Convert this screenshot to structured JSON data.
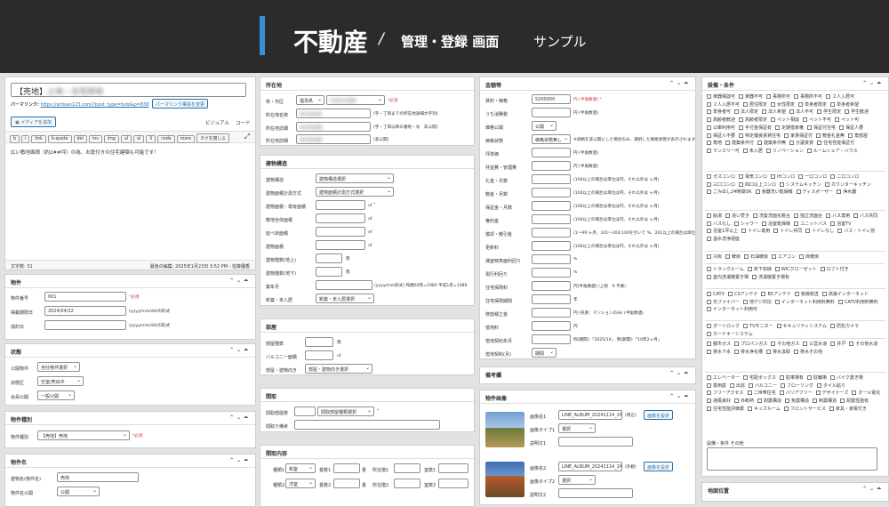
{
  "banner": {
    "title": "不動産",
    "slash": "/",
    "subtitle": "管理・登録 画面",
    "sample": "サンプル"
  },
  "post": {
    "title_prefix": "【売地】",
    "title_blur": "土地・住宅用地",
    "permalink_label": "パーマリンク:",
    "permalink_url": "https://artisan123.com/?post_type=fudo&p=838",
    "permalink_btn": "パーマリンク構造を変更",
    "media_btn": "メディアを追加",
    "tab_visual": "ビジュアル",
    "tab_code": "コード",
    "qtags": [
      "b",
      "i",
      "link",
      "b-quote",
      "del",
      "ins",
      "img",
      "ul",
      "ol",
      "li",
      "code",
      "more",
      "タグを閉じる"
    ],
    "body_text": "広い敷地面積（約2##坪）の為、お庭付きの住宅建築も可能です！",
    "wordcount": "文字数: 31",
    "lastedit": "最後の編集: 2025年1月23日 3:52 PM - 佐藤優香"
  },
  "col1": {
    "bukken": {
      "title": "物件",
      "rows": [
        {
          "label": "物件番号",
          "value": "001",
          "note": "*必須"
        },
        {
          "label": "掲載期限日",
          "value": "2024/04/22",
          "note": "(yyyy/mm/dd)の形式"
        },
        {
          "label": "成約日",
          "value": "",
          "note": "(yyyy/mm/dd)の形式"
        }
      ]
    },
    "jotai": {
      "title": "状態",
      "rows": [
        {
          "label": "公開物件",
          "value": "自社物件選択"
        },
        {
          "label": "状態区",
          "value": "空室/売出中"
        },
        {
          "label": "会員公開",
          "value": "一般公開"
        }
      ]
    },
    "shubetsu": {
      "title": "物件種別",
      "label": "物件種別",
      "value": "【売地】売地",
      "note": "*必須"
    },
    "name": {
      "title": "物件名",
      "rows": [
        {
          "label": "建物名(物件名)",
          "value": "売地"
        },
        {
          "label": "物件名公開",
          "value": "公開"
        }
      ]
    }
  },
  "col2": {
    "location": {
      "title": "所在地",
      "rows": [
        {
          "label": "県・市区",
          "v1": "福島県",
          "v2": "市区町村選択",
          "note": "*必須"
        },
        {
          "label": "所在地名称",
          "value": "所在地名称",
          "note": "(字・丁目までの所在地詳細文字列)"
        },
        {
          "label": "所在地詳細",
          "value": "所在地詳細",
          "note": "(字・丁目以降の番地・号　非公開)"
        },
        {
          "label": "所在地詳細",
          "value": "所在地詳細",
          "note": "(非公開)"
        }
      ]
    },
    "building": {
      "title": "建物構造",
      "rows": [
        {
          "label": "建物構造",
          "value": "建物構造選択"
        },
        {
          "label": "建物面積計測方式",
          "value": "建物面積計測方式選択"
        },
        {
          "label": "建物面積・専有面積",
          "value": "",
          "unit": "㎡",
          "note": "*"
        },
        {
          "label": "敷地全体面積",
          "value": "",
          "unit": "㎡"
        },
        {
          "label": "延べ床面積",
          "value": "",
          "unit": "㎡"
        },
        {
          "label": "建物面積",
          "value": "",
          "unit": "㎡"
        },
        {
          "label": "建物階数(地上)",
          "value": "",
          "unit": "階"
        },
        {
          "label": "建物階数(地下)",
          "value": "",
          "unit": "階"
        },
        {
          "label": "築年月",
          "value": "",
          "note": "(yyyy/mm形式) 和暦60年=1985 平成1年=1989"
        },
        {
          "label": "新築・未入居",
          "value": "新築・未入居選択"
        }
      ]
    },
    "heya": {
      "title": "部屋",
      "rows": [
        {
          "label": "部屋階数",
          "unit": "階"
        },
        {
          "label": "バルコニー面積",
          "unit": "㎡"
        },
        {
          "label": "部屋・建物向き",
          "value": "部屋・建物向き選択"
        }
      ]
    },
    "madori": {
      "title": "間取",
      "rows": [
        {
          "label": "間取部屋数",
          "value": "間取部屋種類選択",
          "note": "*"
        },
        {
          "label": "間取り備考",
          "value": ""
        }
      ]
    },
    "madori_detail": {
      "title": "間取内容",
      "labels": [
        "種類1",
        "畳数1",
        "畳",
        "所在階1",
        "室数1"
      ],
      "labels2": [
        "種類2",
        "畳数2",
        "畳",
        "所在階2",
        "室数2"
      ],
      "type1": "和室",
      "type2": "洋室"
    }
  },
  "col3": {
    "fees": {
      "title": "金額等",
      "rows": [
        {
          "label": "賃料・価格",
          "value": "5200000",
          "note": "円 (半角数値) *"
        },
        {
          "label": "うち消費税",
          "value": "",
          "note": "円 (半角数値)"
        },
        {
          "label": "価格公開",
          "value": "公開"
        },
        {
          "label": "価格状態",
          "value": "価格状態無し",
          "note": "※価格を非公開にした場合のみ、選択した価格状態が表示されます。"
        },
        {
          "label": "坪単価",
          "value": "",
          "note": "円 (半角数値)"
        },
        {
          "label": "共益費・管理費",
          "value": "",
          "note": "円 (半角数値)"
        },
        {
          "label": "礼金・月数",
          "value": "",
          "note": "(100以上の場合は単位は円、それ以外は ヶ月)"
        },
        {
          "label": "敷金・月数",
          "value": "",
          "note": "(100以上の場合は単位は円、それ以外は ヶ月)"
        },
        {
          "label": "保証金・月数",
          "value": "",
          "note": "(100以上の場合は単位は円、それ以外は ヶ月)"
        },
        {
          "label": "権利金",
          "value": "",
          "note": "(100以上の場合は単位は円、それ以外は ヶ月)"
        },
        {
          "label": "償却・敷引金",
          "value": "",
          "note": "(1〜99:ヶ月、101〜200:100を引いて %、201以上の場合は単位は円)"
        },
        {
          "label": "更新料",
          "value": "",
          "note": "(100以上の場合は単位は円、それ以外は ヶ月)"
        },
        {
          "label": "満室時表面利回り",
          "value": "",
          "note": "%"
        },
        {
          "label": "現行利回り",
          "value": "",
          "note": "%"
        },
        {
          "label": "住宅保険料",
          "value": "",
          "note": "円(半角数値) (上限　9 不要)"
        },
        {
          "label": "住宅保険期間",
          "value": "",
          "note": "年"
        },
        {
          "label": "修繕積立金",
          "value": "",
          "note": "円 (売買：マンションのみ) (半角数値)"
        },
        {
          "label": "借地料",
          "value": "",
          "note": "円"
        },
        {
          "label": "借地契約年月",
          "value": "",
          "note": "例(期間):「2025/10」 例(期間):「10年2ヶ月」"
        },
        {
          "label": "借地契約(月)",
          "value": "期間"
        }
      ]
    },
    "bikou": {
      "title": "備考欄"
    },
    "images": {
      "title": "物件画像",
      "items": [
        {
          "name_label": "画像名1",
          "name": "LINE_ALBUM_20241114_2411",
          "kind": "(周辺)",
          "btn": "画像を設定",
          "type_label": "画像タイプ1",
          "type": "選択",
          "desc_label": "説明文1"
        },
        {
          "name_label": "画像名2",
          "name": "LINE_ALBUM_20241114_2411",
          "kind": "(外観)",
          "btn": "画像を設定",
          "type_label": "画像タイプ2",
          "type": "選択",
          "desc_label": "説明文2"
        }
      ]
    }
  },
  "col4": {
    "facilities": {
      "title": "設備・条件",
      "groups": [
        [
          "楽器相談可",
          "楽器不可",
          "事務所可",
          "事務所不可",
          "２人入居可",
          "２人入居不可",
          "居住限定",
          "女性限定",
          "単身者限定",
          "単身者希望",
          "単身者可",
          "法人限定",
          "法人希望",
          "法人不可",
          "学生限定",
          "学生歓迎",
          "高齢者歓迎",
          "高齢者限定",
          "ペット相談",
          "ペット不可",
          "ペット可",
          "公庫利用可",
          "手付金保証有",
          "定期借家権",
          "保証付住宅",
          "保証人要",
          "保証人不要",
          "特定優良賃貸住宅",
          "家賃保証付",
          "敷金礼金無",
          "角部屋",
          "角地",
          "建築条件付",
          "建築条件無",
          "分譲賃貸",
          "住宅性能保証付",
          "マンスリー可",
          "未入居",
          "リノベーション",
          "ルームシェア・ハウス"
        ],
        [
          "ガスコンロ",
          "電気コンロ",
          "IHコンロ",
          "一口コンロ",
          "二口コンロ",
          "三口コンロ",
          "四口以上コンロ",
          "システムキッチン",
          "カウンターキッチン",
          "ごみ出し24時間OK",
          "食器洗い乾燥機",
          "ディスポーザー",
          "浄水器"
        ],
        [
          "給湯",
          "追い焚き",
          "洗髪洗面化粧台",
          "独立洗面台",
          "バス専用",
          "バス共同",
          "バスなし",
          "シャワー",
          "浴室乾燥機",
          "ユニットバス",
          "浴室TV",
          "浴室1坪以上",
          "トイレ専用",
          "トイレ共同",
          "トイレなし",
          "バス・トイレ別",
          "温水洗浄便座"
        ],
        [
          "冷房",
          "暖房",
          "石油暖房",
          "エアコン",
          "床暖房"
        ],
        [
          "トランクルーム",
          "床下収納",
          "WICクローゼット",
          "ロフト付き",
          "室内洗濯機置き場",
          "洗濯機置き場有"
        ],
        [
          "CATV",
          "CSアンテナ",
          "BSアンテナ",
          "有線放送",
          "高速インターネット",
          "光ファイバー",
          "地デジ対応",
          "インターネット利用料無料",
          "CATV利用料無料",
          "インターネット利用可"
        ],
        [
          "オートロック",
          "TVモニター",
          "セキュリティシステム",
          "防犯カメラ",
          "カードキーシステム"
        ],
        [
          "都市ガス",
          "プロパンガス",
          "その他ガス",
          "公営水道",
          "井戸",
          "その他水道",
          "排水下水",
          "排水浄化槽",
          "排水汲取",
          "排水その他"
        ],
        [
          "エレベーター",
          "宅配ボックス",
          "駐車場有",
          "駐輪場",
          "バイク置き場",
          "専用庭",
          "出窓",
          "バルコニー",
          "フローリング",
          "タイル貼り",
          "フリーアクセス",
          "二世帯住宅",
          "バリアフリー",
          "デザイナーズ",
          "オール電化",
          "通風良好",
          "外断熱",
          "耐震構造",
          "免震構造",
          "制震構造",
          "耐震性能有",
          "住宅性能評価書",
          "キッズルーム",
          "フロントサービス",
          "家具・家電付き"
        ]
      ],
      "other_label": "設備・条件 その他"
    },
    "map": {
      "title": "地図位置"
    }
  }
}
